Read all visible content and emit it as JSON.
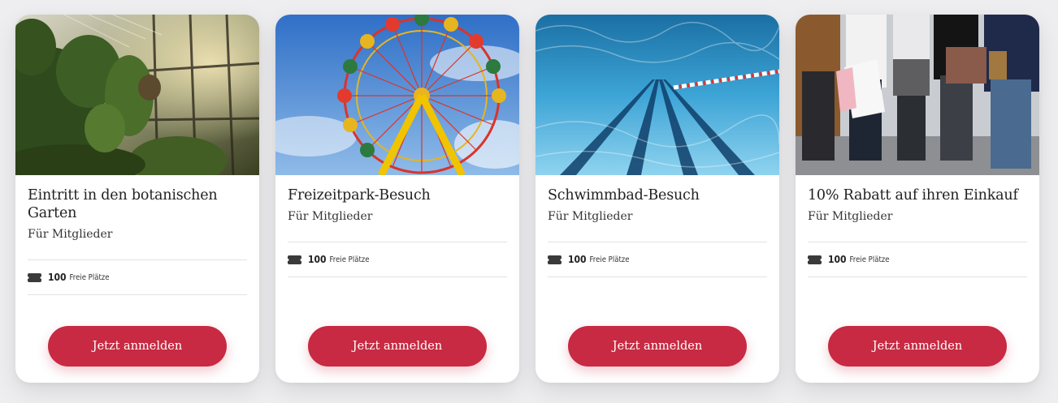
{
  "cards": [
    {
      "title": "Eintritt in den botanischen Garten",
      "subtitle": "Für Mitglieder",
      "seats_count": "100",
      "seats_label": "Freie Plätze",
      "cta_label": "Jetzt anmelden"
    },
    {
      "title": "Freizeitpark-Besuch",
      "subtitle": "Für Mitglieder",
      "seats_count": "100",
      "seats_label": "Freie Plätze",
      "cta_label": "Jetzt anmelden"
    },
    {
      "title": "Schwimmbad-Besuch",
      "subtitle": "Für Mitglieder",
      "seats_count": "100",
      "seats_label": "Freie Plätze",
      "cta_label": "Jetzt anmelden"
    },
    {
      "title": "10% Rabatt auf ihren Einkauf",
      "subtitle": "Für Mitglieder",
      "seats_count": "100",
      "seats_label": "Freie Plätze",
      "cta_label": "Jetzt anmelden"
    }
  ],
  "icons": {
    "seats": "ticket-icon"
  },
  "colors": {
    "accent": "#c72a42",
    "background": "#eeeef0",
    "card": "#ffffff"
  }
}
